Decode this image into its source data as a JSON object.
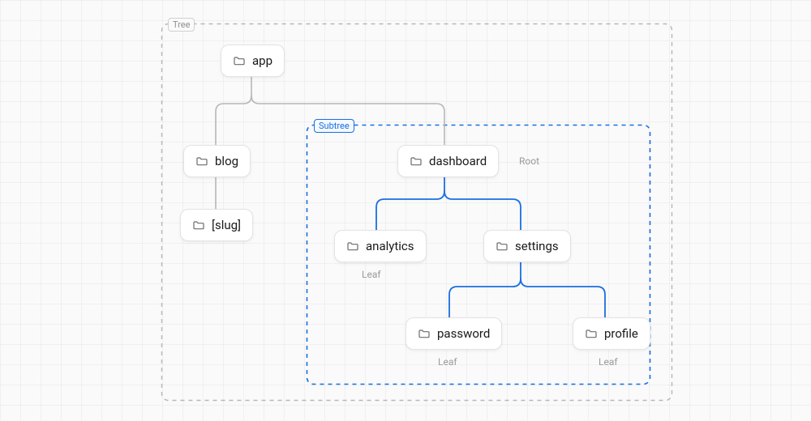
{
  "labels": {
    "tree": "Tree",
    "subtree": "Subtree"
  },
  "annotations": {
    "root": "Root",
    "leaf": "Leaf"
  },
  "nodes": {
    "app": {
      "label": "app"
    },
    "blog": {
      "label": "blog"
    },
    "slug": {
      "label": "[slug]"
    },
    "dashboard": {
      "label": "dashboard"
    },
    "analytics": {
      "label": "analytics"
    },
    "settings": {
      "label": "settings"
    },
    "password": {
      "label": "password"
    },
    "profile": {
      "label": "profile"
    }
  },
  "hierarchy": {
    "app": [
      "blog",
      "dashboard"
    ],
    "blog": [
      "slug"
    ],
    "dashboard": [
      "analytics",
      "settings"
    ],
    "settings": [
      "password",
      "profile"
    ]
  },
  "subtree_root": "dashboard",
  "colors": {
    "grey": "#b7b7b7",
    "blue": "#1a6fe0"
  }
}
